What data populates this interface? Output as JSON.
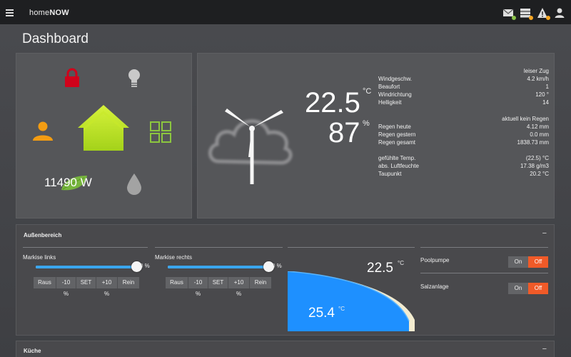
{
  "app": {
    "brand_prefix": "home",
    "brand_suffix": "NOW"
  },
  "header": {
    "icons": [
      {
        "name": "mail-icon",
        "badge_color": "#8bc34a"
      },
      {
        "name": "server-icon",
        "badge_color": "#f5a623"
      },
      {
        "name": "warning-icon",
        "badge_color": "#f5a623"
      },
      {
        "name": "user-icon"
      }
    ]
  },
  "page": {
    "title": "Dashboard"
  },
  "home_panel": {
    "power": "11490 W",
    "icons": [
      "lock-icon",
      "bulb-icon",
      "person-icon",
      "house-icon",
      "windows-icon",
      "leaf-icon",
      "drop-icon"
    ],
    "colors": {
      "lock": "#d0021b",
      "house": "#b6e31c",
      "person": "#f39c12",
      "windows": "#8cc63f"
    }
  },
  "weather": {
    "temperature": "22.5",
    "temperature_unit": "°C",
    "humidity": "87",
    "humidity_unit": "%",
    "wind_status": "leiser Zug",
    "wind_rows": [
      {
        "label": "Windgeschw.",
        "value": "4.2 km/h"
      },
      {
        "label": "Beaufort",
        "value": "1"
      },
      {
        "label": "Windrichtung",
        "value": "120 °"
      },
      {
        "label": "Helligkeit",
        "value": "14"
      }
    ],
    "rain_status": "aktuell kein Regen",
    "rain_rows": [
      {
        "label": "Regen heute",
        "value": "4.12 mm"
      },
      {
        "label": "Regen gestern",
        "value": "0.0 mm"
      },
      {
        "label": "Regen gesamt",
        "value": "1838.73 mm"
      }
    ],
    "other_rows": [
      {
        "label": "gefühlte Temp.",
        "value": "(22.5) °C"
      },
      {
        "label": "abs. Luftfeuchte",
        "value": "17.38 g/m3"
      },
      {
        "label": "Taupunkt",
        "value": "20.2 °C"
      }
    ]
  },
  "outdoor": {
    "title": "Außenbereich",
    "toggle": "−",
    "awnings": [
      {
        "label": "Markise links",
        "value": "0 %",
        "level": 1.0
      },
      {
        "label": "Markise rechts",
        "value": "0 %",
        "level": 1.0
      }
    ],
    "awning_buttons": [
      "Raus",
      "-10 %",
      "SET",
      "+10 %",
      "Rein"
    ],
    "pool": {
      "air_temp": "22.5",
      "water_temp": "25.4",
      "unit": "°C",
      "water_color": "#1e90ff"
    },
    "switches": [
      {
        "label": "Poolpumpe",
        "on": "On",
        "off": "Off"
      },
      {
        "label": "Salzanlage",
        "on": "On",
        "off": "Off"
      }
    ]
  },
  "kitchen": {
    "title": "Küche",
    "toggle": "−"
  }
}
